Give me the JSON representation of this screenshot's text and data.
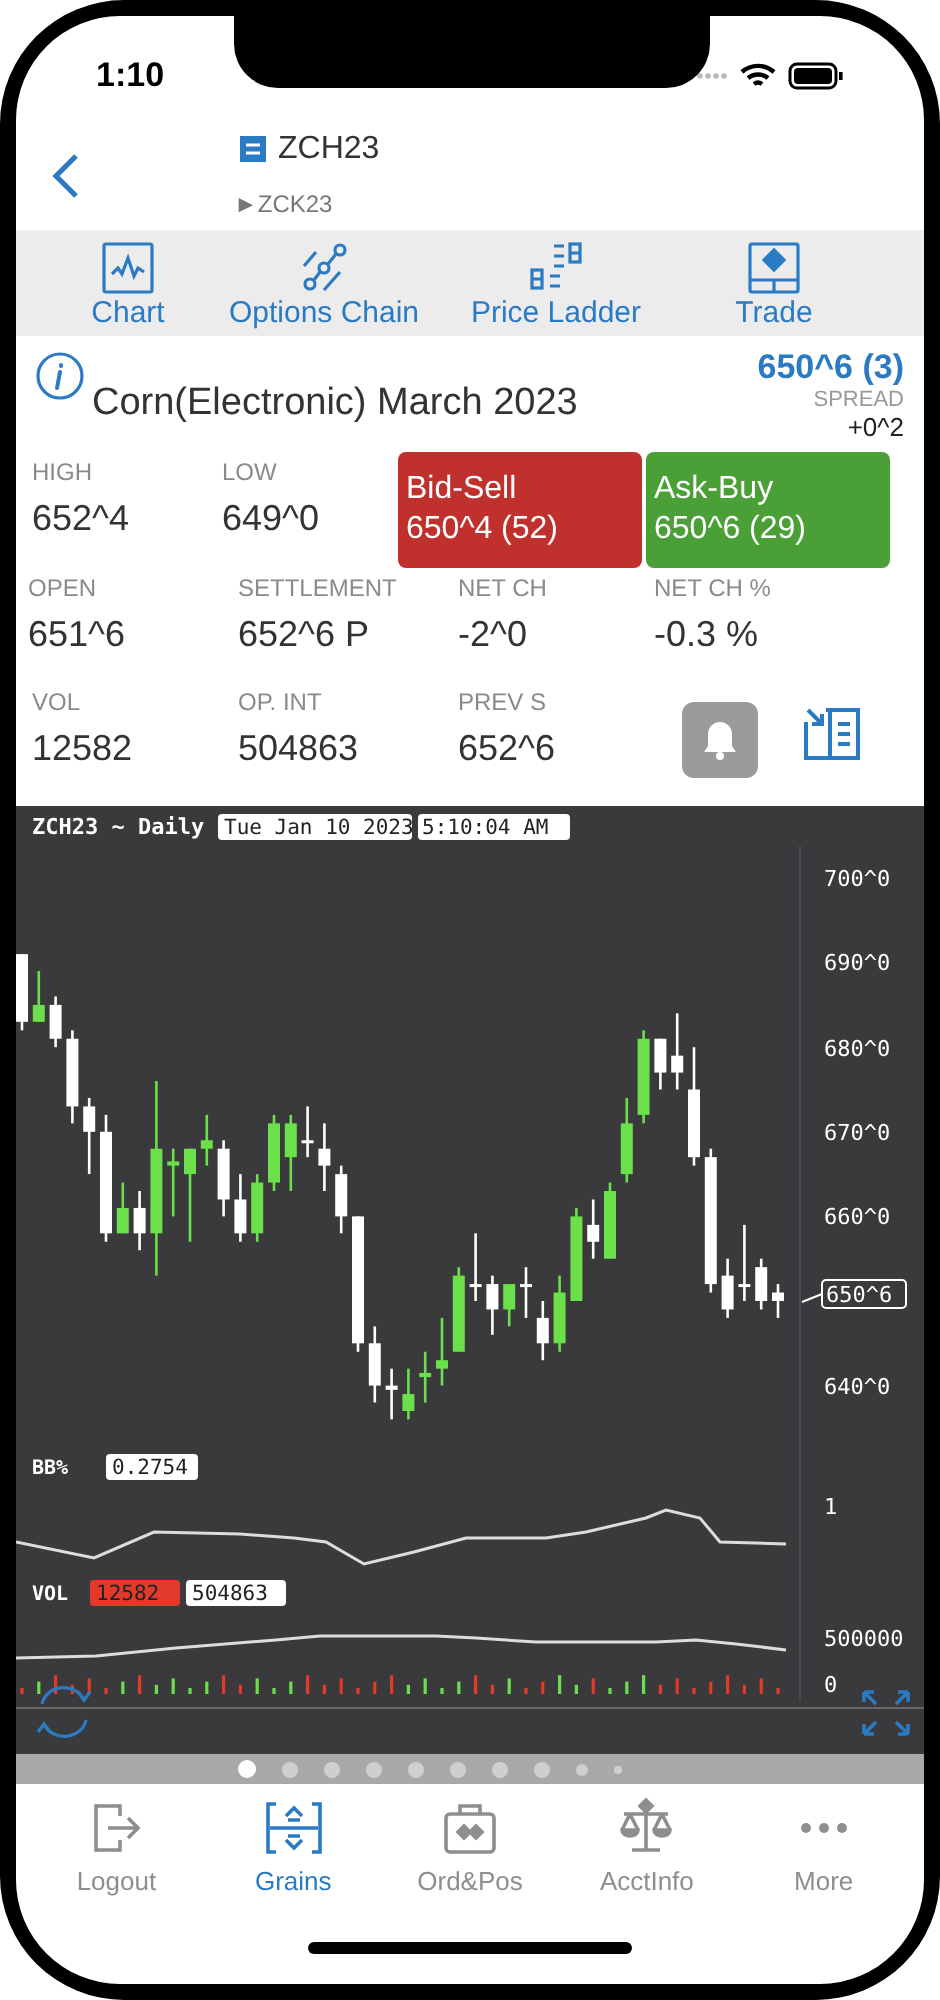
{
  "status_bar": {
    "time": "1:10"
  },
  "header": {
    "symbol": "ZCH23",
    "next_symbol": "►ZCK23"
  },
  "toolbar": [
    {
      "label": "Chart",
      "kind": "chart"
    },
    {
      "label": "Options Chain",
      "kind": "options"
    },
    {
      "label": "Price Ladder",
      "kind": "ladder"
    },
    {
      "label": "Trade",
      "kind": "trade"
    }
  ],
  "instrument": {
    "name": "Corn(Electronic) March 2023",
    "last": "650^6 (3)",
    "spread_label": "SPREAD",
    "spread": "+0^2"
  },
  "stats_row_1": [
    {
      "label": "HIGH",
      "value": "652^4"
    },
    {
      "label": "LOW",
      "value": "649^0"
    }
  ],
  "quotes": [
    {
      "label": "Bid-Sell",
      "value": "650^4 (52)",
      "kind": "bid"
    },
    {
      "label": "Ask-Buy",
      "value": "650^6 (29)",
      "kind": "ask"
    }
  ],
  "stats_row_2": [
    {
      "label": "OPEN",
      "value": "651^6"
    },
    {
      "label": "SETTLEMENT",
      "value": "652^6 P"
    },
    {
      "label": "NET CH",
      "value": "-2^0"
    },
    {
      "label": "NET CH %",
      "value": "-0.3 %"
    }
  ],
  "stats_row_3": [
    {
      "label": "VOL",
      "value": "12582"
    },
    {
      "label": "OP. INT",
      "value": "504863"
    },
    {
      "label": "PREV S",
      "value": "652^6"
    }
  ],
  "chart": {
    "title": "ZCH23 ~ Daily",
    "date": "Tue Jan 10 2023",
    "time": "5:10:04 AM",
    "price_labels": [
      "700^0",
      "690^0",
      "680^0",
      "670^0",
      "660^0",
      "640^0"
    ],
    "last_price_tag": "650^6",
    "bb_label": "BB%",
    "bb_value": "0.2754",
    "bb_axis": "1",
    "vol_label": "VOL",
    "vol_value": "12582",
    "open_interest_value": "504863",
    "vol_axis": [
      "500000",
      "0"
    ]
  },
  "pager": [
    {
      "selected": true
    },
    {
      "selected": false
    },
    {
      "selected": false
    },
    {
      "selected": false
    },
    {
      "selected": false
    },
    {
      "selected": false
    },
    {
      "selected": false
    },
    {
      "selected": false
    },
    {
      "selected": false
    },
    {
      "selected": false
    }
  ],
  "tabs": [
    {
      "label": "Logout",
      "kind": "logout",
      "selected": false
    },
    {
      "label": "Grains",
      "kind": "grains",
      "selected": true
    },
    {
      "label": "Ord&Pos",
      "kind": "orders",
      "selected": false
    },
    {
      "label": "AcctInfo",
      "kind": "account",
      "selected": false
    },
    {
      "label": "More",
      "kind": "more",
      "selected": false
    }
  ]
}
